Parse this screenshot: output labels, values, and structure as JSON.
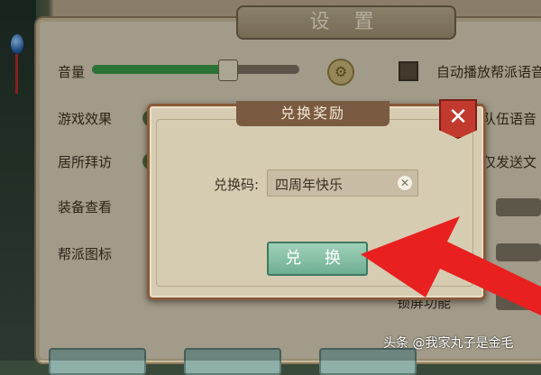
{
  "settings": {
    "title": "设 置",
    "volume_label": "音量",
    "volume_level": 0.65,
    "game_effects_label": "游戏效果",
    "residence_visit_label": "居所拜访",
    "equipment_view_label": "装备查看",
    "guild_icon_label": "帮派图标",
    "auto_play_label": "自动播放帮派语音",
    "team_voice_label": "队伍语音",
    "send_only_label": "仅发送文",
    "lock_screen_label": "锁屏功能"
  },
  "modal": {
    "title": "兑换奖励",
    "code_label": "兑换码:",
    "code_value": "四周年快乐",
    "redeem_button_label": "兑 换",
    "close_icon": "close-icon"
  },
  "watermark": {
    "text": "头条 @我家丸子是金毛"
  },
  "colors": {
    "accent_red": "#e82020",
    "slider_fill": "#3b9a4a",
    "redeem_button": "#7fbda2"
  }
}
